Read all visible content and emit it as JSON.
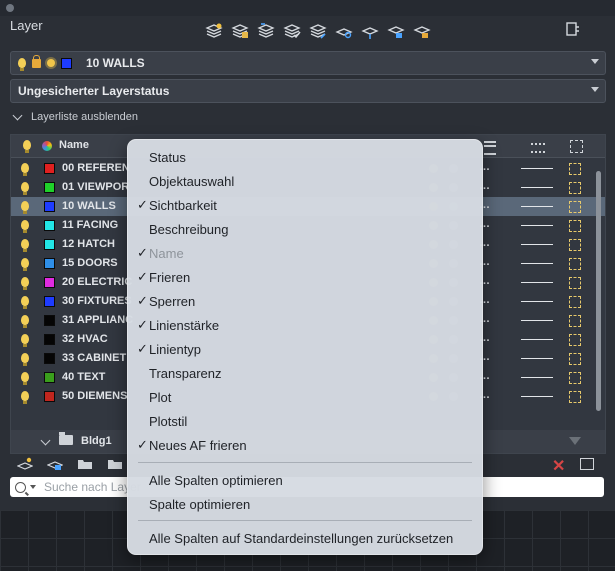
{
  "panel": {
    "title": "Layer"
  },
  "toolbar_icons": [
    "new-layer-icon",
    "new-vp-frozen-layer-icon",
    "layer-states-icon",
    "set-current-icon",
    "match-layer-icon",
    "isolate-layer-icon",
    "unisolate-layer-icon",
    "lock-layer-icon",
    "unlock-layer-icon"
  ],
  "current_layer": {
    "name": "10 WALLS",
    "color": "#1e3cff"
  },
  "layer_state": {
    "label": "Ungesicherter Layerstatus"
  },
  "collapse_label": "Layerliste ausblenden",
  "table": {
    "header_name": "Name",
    "rows": [
      {
        "name": "00 REFEREN",
        "color": "#e02020",
        "selected": false
      },
      {
        "name": "01 VIEWPOR",
        "color": "#1fd12a",
        "selected": false
      },
      {
        "name": "10 WALLS",
        "color": "#1e3cff",
        "selected": true
      },
      {
        "name": "11 FACING",
        "color": "#22e5e5",
        "selected": false
      },
      {
        "name": "12 HATCH",
        "color": "#22e5e5",
        "selected": false
      },
      {
        "name": "15 DOORS",
        "color": "#2f8fe8",
        "selected": false
      },
      {
        "name": "20 ELECTRIC",
        "color": "#e02be0",
        "selected": false
      },
      {
        "name": "30 FIXTURES",
        "color": "#1e3cff",
        "selected": false
      },
      {
        "name": "31 APPLIANC",
        "color": "#050505",
        "selected": false
      },
      {
        "name": "32 HVAC",
        "color": "#050505",
        "selected": false
      },
      {
        "name": "33 CABINET",
        "color": "#050505",
        "selected": false
      },
      {
        "name": "40 TEXT",
        "color": "#3a9e1c",
        "selected": false
      },
      {
        "name": "50 DIEMENS",
        "color": "#c0261e",
        "selected": false
      }
    ],
    "row_ellipsis": "…",
    "group": {
      "name": "Bldg1"
    }
  },
  "search": {
    "placeholder": "Suche nach Layer",
    "value": ""
  },
  "context_menu": {
    "items": [
      {
        "label": "Status",
        "checked": false,
        "disabled": false
      },
      {
        "label": "Objektauswahl",
        "checked": false,
        "disabled": false
      },
      {
        "label": "Sichtbarkeit",
        "checked": true,
        "disabled": false
      },
      {
        "label": "Beschreibung",
        "checked": false,
        "disabled": false
      },
      {
        "label": "Name",
        "checked": true,
        "disabled": true
      },
      {
        "label": "Frieren",
        "checked": true,
        "disabled": false
      },
      {
        "label": "Sperren",
        "checked": true,
        "disabled": false
      },
      {
        "label": "Linienstärke",
        "checked": true,
        "disabled": false
      },
      {
        "label": "Linientyp",
        "checked": true,
        "disabled": false
      },
      {
        "label": "Transparenz",
        "checked": false,
        "disabled": false
      },
      {
        "label": "Plot",
        "checked": false,
        "disabled": false
      },
      {
        "label": "Plotstil",
        "checked": false,
        "disabled": false
      },
      {
        "label": "Neues AF frieren",
        "checked": true,
        "disabled": false
      }
    ],
    "optimize_all": "Alle Spalten optimieren",
    "optimize_one": "Spalte optimieren",
    "reset": "Alle Spalten auf Standardeinstellungen zurücksetzen"
  },
  "checkmark": "✓"
}
